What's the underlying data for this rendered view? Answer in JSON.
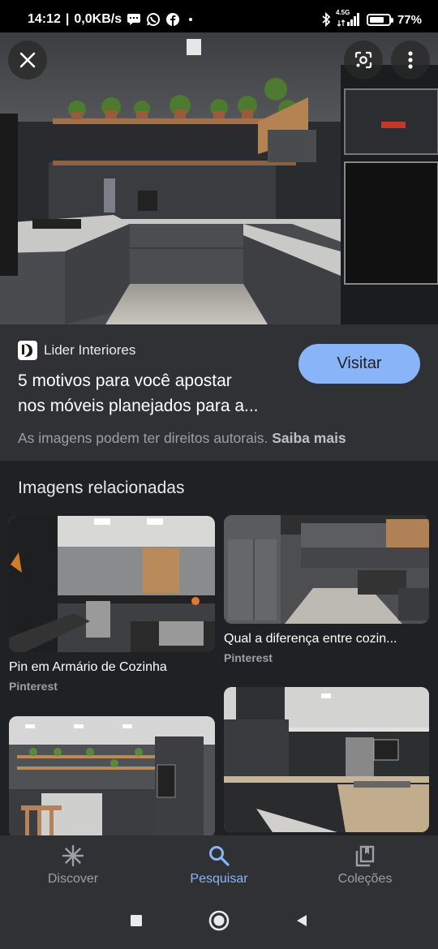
{
  "status_bar": {
    "time": "14:12",
    "net_speed": "0,0KB/s",
    "network_type": "4.5G",
    "battery_percent": "77%",
    "battery_level": 0.77
  },
  "hero": {
    "close_icon": "close-icon",
    "lens_icon": "google-lens-icon",
    "more_icon": "more-vert-icon"
  },
  "result": {
    "source_name": "Lider Interiores",
    "title_line1": "5 motivos para você apostar",
    "title_line2": "nos móveis planejados para a...",
    "visit_label": "Visitar",
    "copyright_text": "As imagens podem ter direitos autorais.",
    "learn_more_label": "Saiba mais"
  },
  "related": {
    "heading": "Imagens relacionadas",
    "items": [
      {
        "title": "Pin em Armário de Cozinha",
        "source": "Pinterest"
      },
      {
        "title": "Qual a diferença entre cozin...",
        "source": "Pinterest"
      },
      {
        "title": "",
        "source": ""
      },
      {
        "title": "",
        "source": ""
      }
    ]
  },
  "bottom_nav": {
    "items": [
      {
        "label": "Discover",
        "icon": "discover-asterisk-icon"
      },
      {
        "label": "Pesquisar",
        "icon": "search-icon"
      },
      {
        "label": "Coleções",
        "icon": "collections-bookmark-icon"
      }
    ]
  },
  "colors": {
    "accent": "#8ab4f8",
    "background": "#303134",
    "related_background": "#202124"
  }
}
